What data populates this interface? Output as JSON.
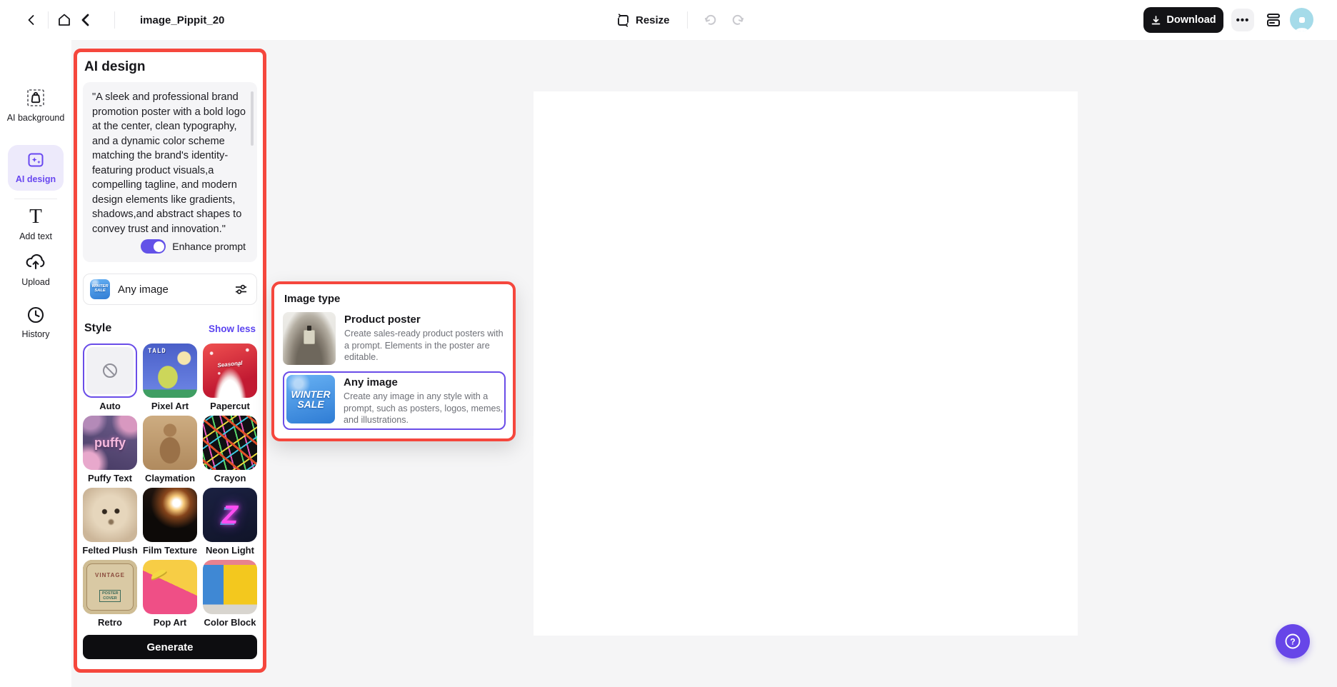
{
  "colors": {
    "accent": "#6847f0",
    "annotation_red": "#f5473d",
    "toggle_on": "#6352e8",
    "download_button_bg": "#131316",
    "avatar_bg": "#a5dbe9",
    "help_button_bg": "#6746e8",
    "canvas_bg": "#ffffff",
    "workspace_bg": "#f5f5f6"
  },
  "topbar": {
    "title": "image_Pippit_20",
    "resize_label": "Resize",
    "download_label": "Download",
    "more_label": "•••"
  },
  "sidebar": {
    "items": [
      {
        "label": "AI background",
        "icon": "ai-background-icon",
        "active": false
      },
      {
        "label": "AI design",
        "icon": "ai-design-icon",
        "active": true
      },
      {
        "label": "Add text",
        "icon": "add-text-icon",
        "active": false
      },
      {
        "label": "Upload",
        "icon": "upload-icon",
        "active": false
      },
      {
        "label": "History",
        "icon": "history-icon",
        "active": false
      }
    ]
  },
  "panel": {
    "title": "AI design",
    "prompt": "\"A sleek and professional brand promotion poster with a bold logo at the center, clean typography, and a dynamic color scheme matching the brand's identity-featuring product visuals,a compelling tagline, and modern design elements like gradients, shadows,and abstract shapes to convey trust and innovation.\"",
    "enhance_label": "Enhance prompt",
    "enhance_on": true,
    "image_type_selected": "Any image",
    "style_header": "Style",
    "show_less_label": "Show less",
    "styles": [
      {
        "label": "Auto",
        "selected": true
      },
      {
        "label": "Pixel Art",
        "thumb_text": "TALD"
      },
      {
        "label": "Papercut",
        "thumb_text": "Seasonal"
      },
      {
        "label": "Puffy Text",
        "thumb_text": "puffy"
      },
      {
        "label": "Claymation"
      },
      {
        "label": "Crayon"
      },
      {
        "label": "Felted Plush"
      },
      {
        "label": "Film Texture"
      },
      {
        "label": "Neon Light",
        "thumb_text": "Z"
      },
      {
        "label": "Retro",
        "thumb_text": "VINTAGE",
        "thumb_text2": "POSTER COVER"
      },
      {
        "label": "Pop Art"
      },
      {
        "label": "Color Block"
      }
    ],
    "generate_label": "Generate"
  },
  "popup": {
    "title": "Image type",
    "options": [
      {
        "title": "Product poster",
        "description": "Create sales-ready product posters with a prompt. Elements in the poster are editable.",
        "selected": false
      },
      {
        "title": "Any image",
        "description": "Create any image in any style with a prompt, such as posters, logos, memes, and illustrations.",
        "selected": true
      }
    ]
  },
  "thumbnails": {
    "winter_line1": "WINTER",
    "winter_line2": "SALE"
  }
}
